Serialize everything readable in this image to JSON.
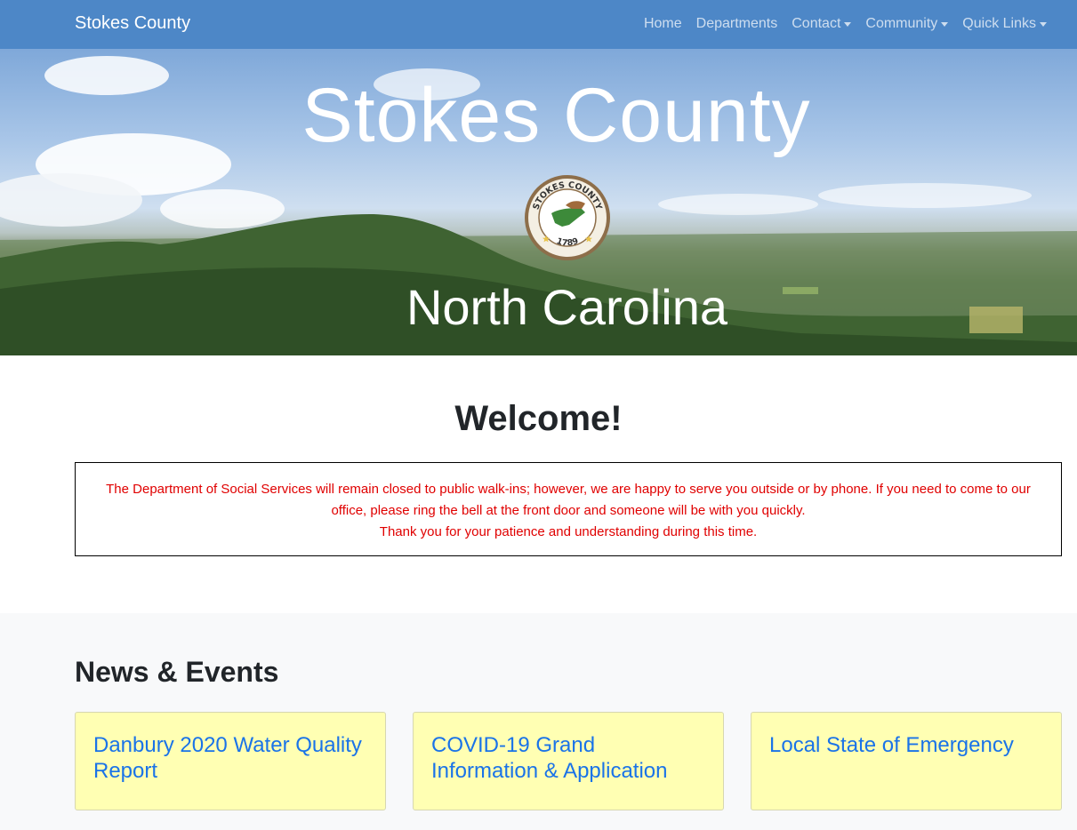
{
  "navbar": {
    "brand": "Stokes County",
    "items": [
      {
        "label": "Home",
        "dropdown": false
      },
      {
        "label": "Departments",
        "dropdown": false
      },
      {
        "label": "Contact",
        "dropdown": true
      },
      {
        "label": "Community",
        "dropdown": true
      },
      {
        "label": "Quick Links",
        "dropdown": true
      }
    ]
  },
  "hero": {
    "title": "Stokes County",
    "subtitle": "North Carolina",
    "seal_top_text": "STOKES COUNTY",
    "seal_year": "1789"
  },
  "welcome": {
    "heading": "Welcome!",
    "notice_line1": "The Department of Social Services will remain closed to public walk-ins; however, we are happy to serve you outside or by phone. If you need to come to our office, please ring the bell at the front door and someone will be with you quickly.",
    "notice_line2": "Thank you for your patience and understanding during this time."
  },
  "news": {
    "title": "News & Events",
    "cards": [
      {
        "label": "Danbury 2020 Water Quality Report"
      },
      {
        "label": "COVID-19 Grand Information & Application"
      },
      {
        "label": "Local State of Emergency"
      }
    ]
  },
  "colors": {
    "navbar": "#4d87c7",
    "notice_text": "#e00000",
    "card_bg": "#ffffb3",
    "link": "#1a73e8"
  }
}
